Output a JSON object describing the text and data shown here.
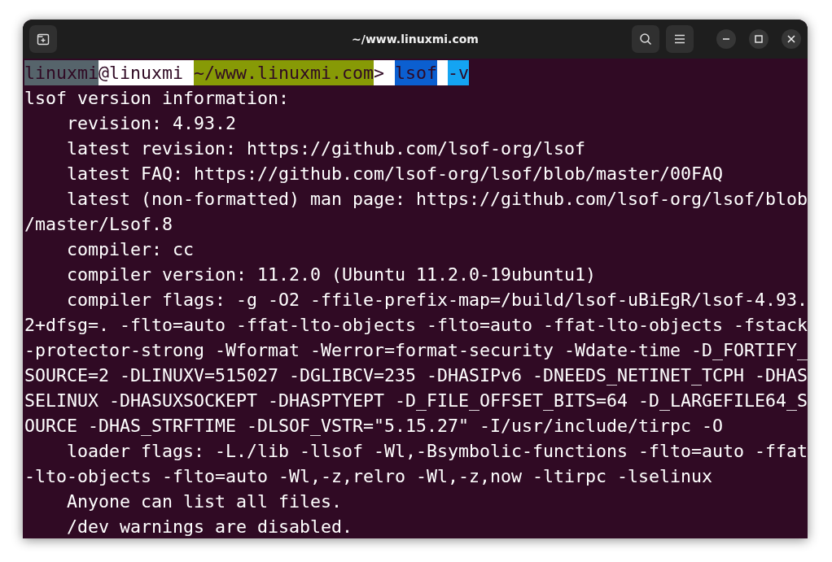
{
  "window": {
    "title": "~/www.linuxmi.com"
  },
  "prompt": [
    {
      "text": "linuxmi",
      "color": "#56646b"
    },
    {
      "text": "@linuxmi ",
      "color": "#ffffff"
    },
    {
      "text": "~/www.linuxmi.com",
      "color": "#879a06"
    },
    {
      "text": "> ",
      "color": "#ffffff"
    },
    {
      "text": "lsof",
      "color": "#0b5fd0"
    },
    {
      "text": "-v",
      "color": "#14a4f2",
      "spaced": true
    }
  ],
  "output": [
    "lsof version information:",
    "    revision: 4.93.2",
    "    latest revision: https://github.com/lsof-org/lsof",
    "    latest FAQ: https://github.com/lsof-org/lsof/blob/master/00FAQ",
    "    latest (non-formatted) man page: https://github.com/lsof-org/lsof/blob",
    "/master/Lsof.8",
    "    compiler: cc",
    "    compiler version: 11.2.0 (Ubuntu 11.2.0-19ubuntu1)",
    "    compiler flags: -g -O2 -ffile-prefix-map=/build/lsof-uBiEgR/lsof-4.93.",
    "2+dfsg=. -flto=auto -ffat-lto-objects -flto=auto -ffat-lto-objects -fstack",
    "-protector-strong -Wformat -Werror=format-security -Wdate-time -D_FORTIFY_",
    "SOURCE=2 -DLINUXV=515027 -DGLIBCV=235 -DHASIPv6 -DNEEDS_NETINET_TCPH -DHAS",
    "SELINUX -DHASUXSOCKEPT -DHASPTYEPT -D_FILE_OFFSET_BITS=64 -D_LARGEFILE64_S",
    "OURCE -DHAS_STRFTIME -DLSOF_VSTR=\"5.15.27\" -I/usr/include/tirpc -O",
    "    loader flags: -L./lib -llsof -Wl,-Bsymbolic-functions -flto=auto -ffat",
    "-lto-objects -flto=auto -Wl,-z,relro -Wl,-z,now -ltirpc -lselinux",
    "    Anyone can list all files.",
    "    /dev warnings are disabled."
  ]
}
